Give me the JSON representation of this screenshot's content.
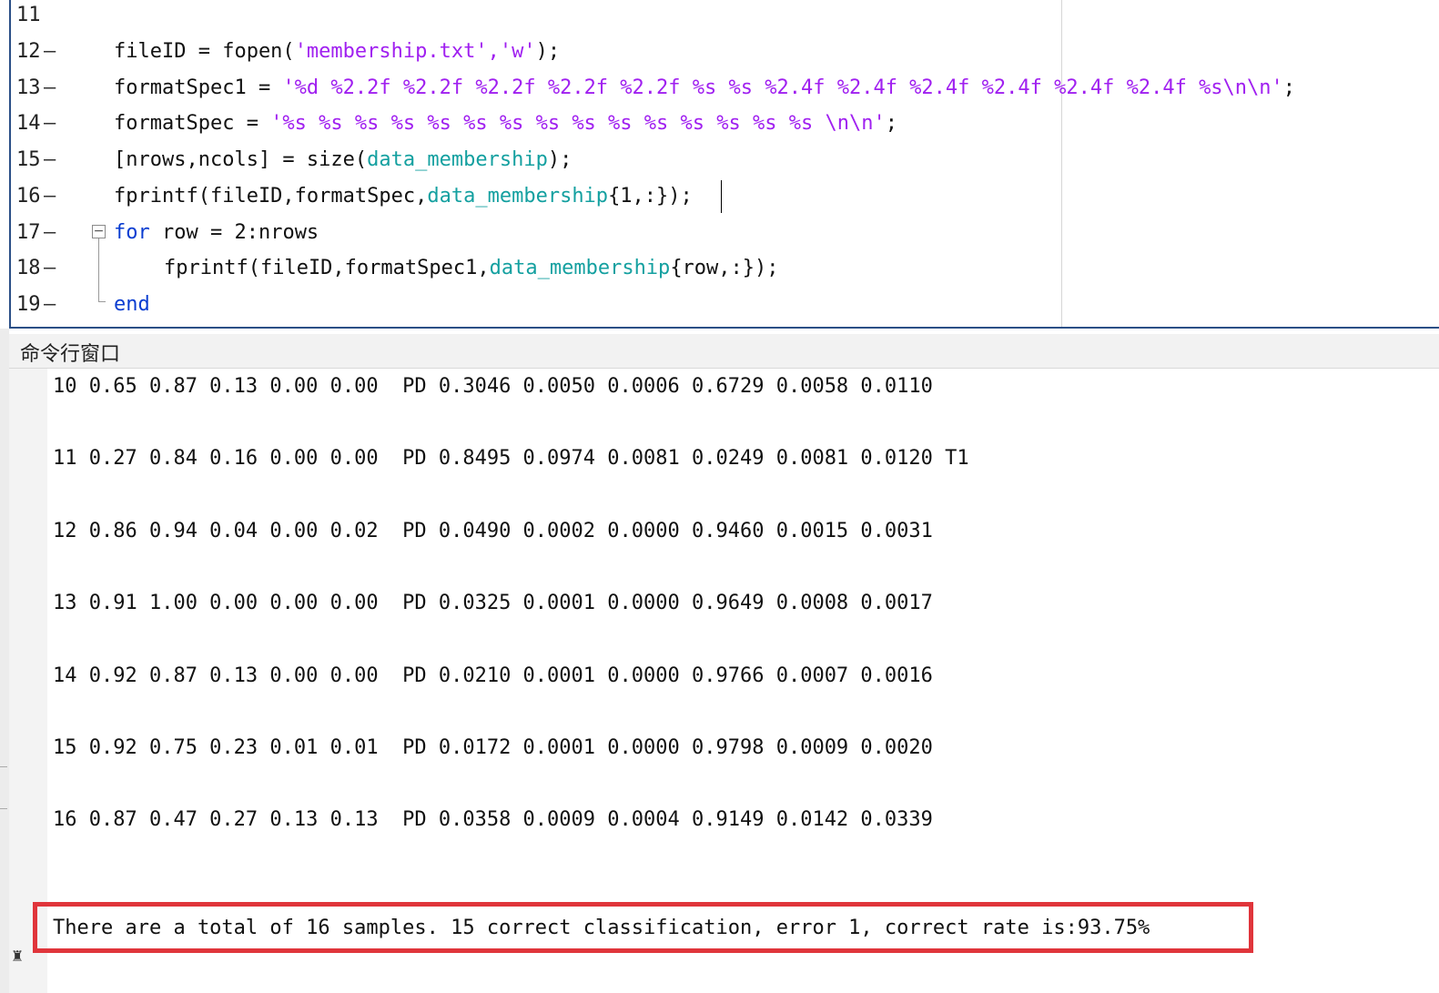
{
  "editor": {
    "lines": [
      {
        "num": "11",
        "dash": ""
      },
      {
        "num": "12",
        "dash": "—"
      },
      {
        "num": "13",
        "dash": "—"
      },
      {
        "num": "14",
        "dash": "—"
      },
      {
        "num": "15",
        "dash": "—"
      },
      {
        "num": "16",
        "dash": "—"
      },
      {
        "num": "17",
        "dash": "—"
      },
      {
        "num": "18",
        "dash": "—"
      },
      {
        "num": "19",
        "dash": "—"
      }
    ],
    "code": {
      "l12a": "fileID = fopen(",
      "l12b": "'membership.txt','w'",
      "l12c": ");",
      "l13a": "formatSpec1 = ",
      "l13b": "'%d %2.2f %2.2f %2.2f %2.2f %2.2f %s %s %2.4f %2.4f %2.4f %2.4f %2.4f %2.4f %s\\n\\n'",
      "l13c": ";",
      "l14a": "formatSpec = ",
      "l14b": "'%s %s %s %s %s %s %s %s %s %s %s %s %s %s %s \\n\\n'",
      "l14c": ";",
      "l15a": "[nrows,ncols] = size(",
      "l15b": "data_membership",
      "l15c": ");",
      "l16a": "fprintf(fileID,formatSpec,",
      "l16b": "data_membership",
      "l16c": "{1,:});",
      "l17a": "for",
      "l17b": " row = 2:nrows",
      "l18a": "fprintf(fileID,formatSpec1,",
      "l18b": "data_membership",
      "l18c": "{row,:});",
      "l19a": "end"
    },
    "fold_symbol": "−"
  },
  "command_window": {
    "title": "命令行窗口",
    "output": [
      "10 0.65 0.87 0.13 0.00 0.00  PD 0.3046 0.0050 0.0006 0.6729 0.0058 0.0110",
      "11 0.27 0.84 0.16 0.00 0.00  PD 0.8495 0.0974 0.0081 0.0249 0.0081 0.0120 T1",
      "12 0.86 0.94 0.04 0.00 0.02  PD 0.0490 0.0002 0.0000 0.9460 0.0015 0.0031",
      "13 0.91 1.00 0.00 0.00 0.00  PD 0.0325 0.0001 0.0000 0.9649 0.0008 0.0017",
      "14 0.92 0.87 0.13 0.00 0.00  PD 0.0210 0.0001 0.0000 0.9766 0.0007 0.0016",
      "15 0.92 0.75 0.23 0.01 0.01  PD 0.0172 0.0001 0.0000 0.9798 0.0009 0.0020",
      "16 0.87 0.47 0.27 0.13 0.13  PD 0.0358 0.0009 0.0004 0.9149 0.0142 0.0339"
    ],
    "summary": "There are a total of 16 samples. 15 correct classification, error 1, correct rate is:93.75%",
    "prompt_icon": "fx-prompt-icon"
  },
  "colors": {
    "keyword": "#0a3dd1",
    "string": "#a020f0",
    "variable": "#14a0a0",
    "highlight_box": "#e0353b",
    "editor_border": "#2b4f86"
  }
}
